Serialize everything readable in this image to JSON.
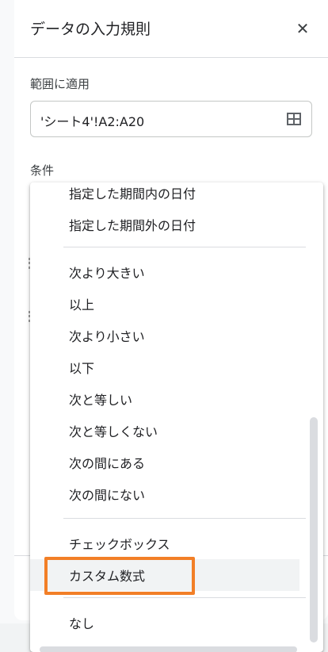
{
  "panel": {
    "title": "データの入力規則",
    "close_glyph": "✕",
    "range_label": "範囲に適用",
    "range_value": "'シート4'!A2:A20",
    "condition_label": "条件"
  },
  "menu": {
    "items": [
      {
        "label": "指定した期間内の日付"
      },
      {
        "label": "指定した期間外の日付"
      },
      {
        "label": "次より大きい"
      },
      {
        "label": "以上"
      },
      {
        "label": "次より小さい"
      },
      {
        "label": "以下"
      },
      {
        "label": "次と等しい"
      },
      {
        "label": "次と等しくない"
      },
      {
        "label": "次の間にある"
      },
      {
        "label": "次の間にない"
      },
      {
        "label": "チェックボックス"
      },
      {
        "label": "カスタム数式"
      },
      {
        "label": "なし"
      }
    ],
    "highlighted_item": "カスタム数式"
  },
  "colors": {
    "highlight_border": "#f27f27",
    "hover_bg": "#f1f3f4"
  }
}
